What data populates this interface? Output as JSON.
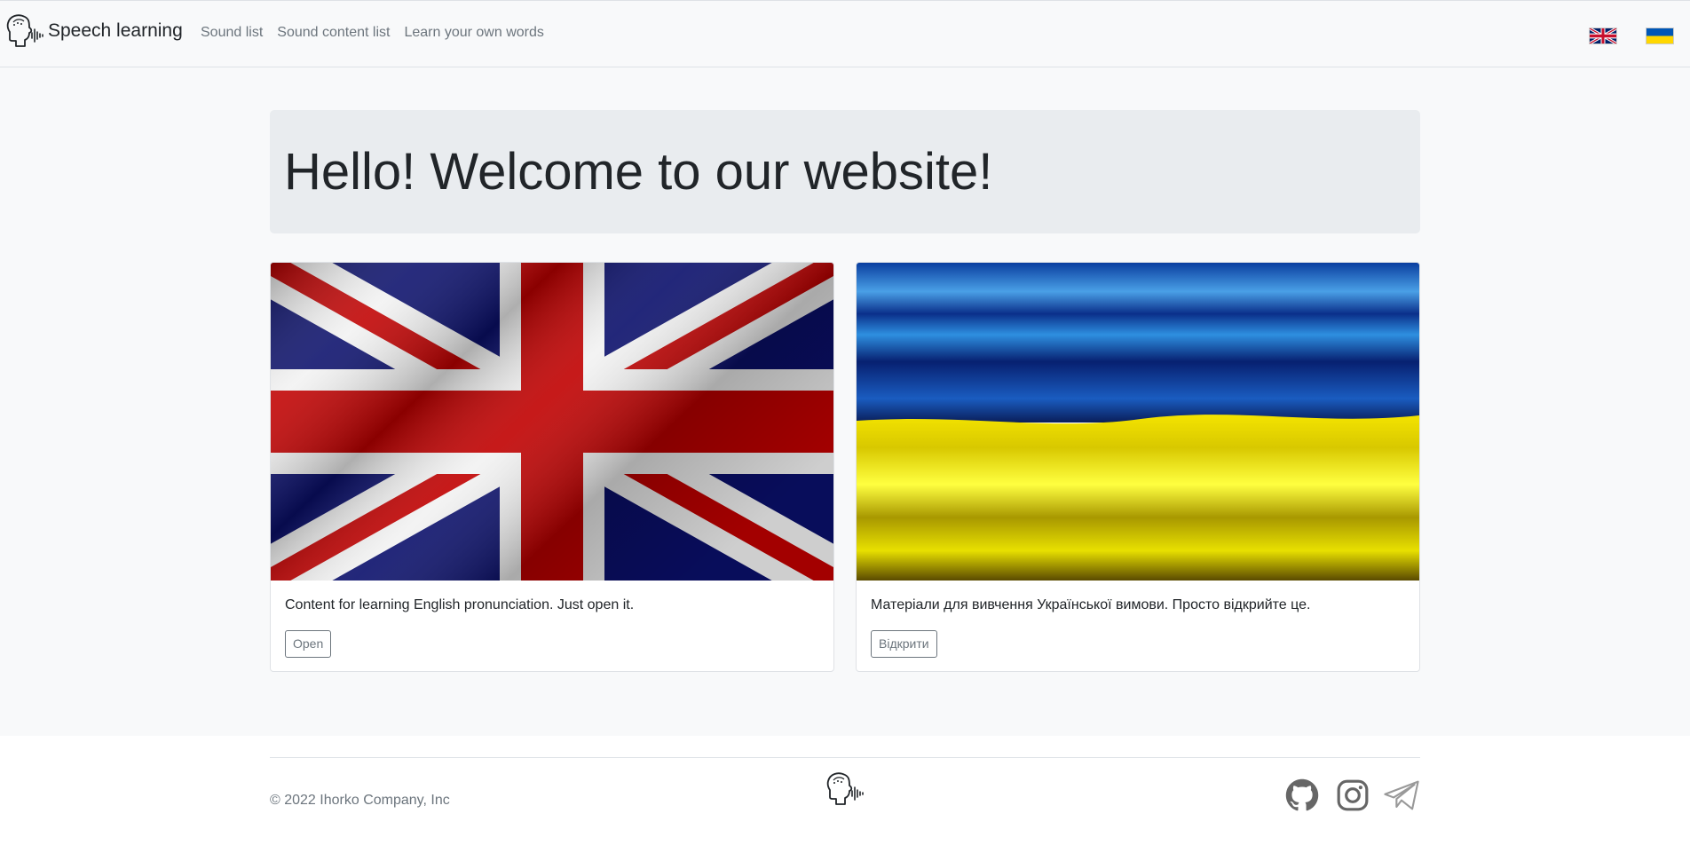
{
  "nav": {
    "brand": "Speech learning",
    "links": [
      "Sound list",
      "Sound content list",
      "Learn your own words"
    ],
    "languages": [
      {
        "code": "en",
        "icon": "uk-flag-icon"
      },
      {
        "code": "ua",
        "icon": "ukraine-flag-icon"
      }
    ]
  },
  "hero": {
    "title": "Hello! Welcome to our website!"
  },
  "cards": [
    {
      "image": "uk-flag-waving",
      "text": "Content for learning English pronunciation. Just open it.",
      "button": "Open"
    },
    {
      "image": "ukraine-flag-waving",
      "text": "Матеріали для вивчення Української вимови. Просто відкрийте це.",
      "button": "Відкрити"
    }
  ],
  "footer": {
    "copyright": "© 2022 Ihorko Company, Inc",
    "socials": [
      "github-icon",
      "instagram-icon",
      "telegram-icon"
    ]
  },
  "colors": {
    "navbar_bg": "#f8f9fa",
    "jumbotron_bg": "#e9ecef",
    "muted_text": "#6c757d",
    "uk_blue": "#012169",
    "uk_red": "#c8102e",
    "ua_blue": "#0057b7",
    "ua_yellow": "#ffd700"
  }
}
